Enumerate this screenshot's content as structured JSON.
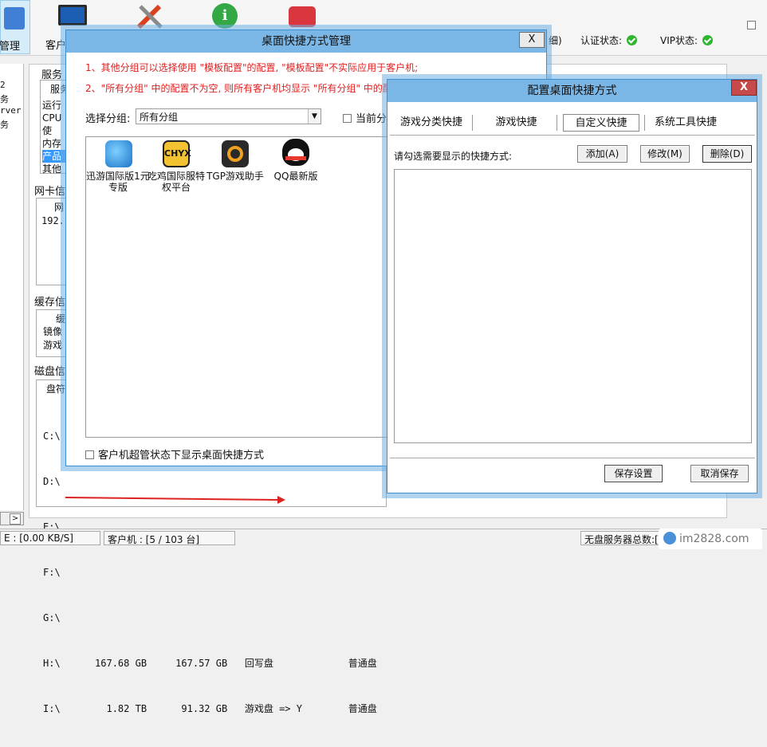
{
  "toolbar": {
    "first_label": "管理",
    "second_label": "客户",
    "status_suffix": "细)",
    "auth_label": "认证状态:",
    "vip_label": "VIP状态:"
  },
  "left_strip": [
    "2",
    "务",
    "rver",
    "务"
  ],
  "server_panel": {
    "group_title": "服务",
    "row_header": "服务",
    "rows": [
      "运行",
      "CPU使",
      "内存",
      "产品",
      "其他"
    ],
    "nic_title": "网卡信",
    "nic_header": "网",
    "nic_row": "192.",
    "cache_title": "缓存信",
    "cache_header": "缓",
    "cache_rows": [
      "镜像",
      "游戏"
    ],
    "disk_title": "磁盘信",
    "disk_header": "盘符",
    "disks": [
      "C:\\",
      "D:\\",
      "E:\\",
      "F:\\",
      "G:\\",
      "H:\\      167.68 GB     167.57 GB   回写盘             普通盘",
      "I:\\        1.82 TB      91.32 GB   游戏盘 => Y        普通盘"
    ]
  },
  "statusbar": {
    "speed": "E : [0.00 KB/S]",
    "clients": "客户机 : [5 / 103 台]",
    "server_total": "无盘服务器总数:[",
    "watermark": "im2828.com"
  },
  "dialog1": {
    "title": "桌面快捷方式管理",
    "close": "X",
    "note1": "1、其他分组可以选择使用 \"模板配置\"的配置, \"模板配置\"不实际应用于客户机;",
    "note2": "2、\"所有分组\" 中的配置不为空, 则所有客户机均显示 \"所有分组\" 中的配",
    "group_label": "选择分组:",
    "group_value": "所有分组",
    "current_label": "当前分",
    "apps": [
      {
        "name": "迅游国际版1元专版",
        "icon": "xunyou-icon"
      },
      {
        "name": "吃鸡国际服特权平台",
        "icon": "chiji-icon"
      },
      {
        "name": "TGP游戏助手",
        "icon": "tgp-icon"
      },
      {
        "name": "QQ最新版",
        "icon": "qq-icon"
      }
    ],
    "footer_check": "客户机超管状态下显示桌面快捷方式"
  },
  "dialog2": {
    "title": "配置桌面快捷方式",
    "close": "X",
    "tabs": [
      "游戏分类快捷",
      "游戏快捷",
      "自定义快捷",
      "系统工具快捷"
    ],
    "active_tab": "自定义快捷",
    "prompt": "请勾选需要显示的快捷方式:",
    "add": "添加(A)",
    "edit": "修改(M)",
    "delete": "删除(D)",
    "save": "保存设置",
    "cancel": "取消保存"
  },
  "colors": {
    "accent": "#7ab6e6",
    "note_red": "#e02020",
    "ok_green": "#2fb52f",
    "close_red": "#c74949"
  }
}
